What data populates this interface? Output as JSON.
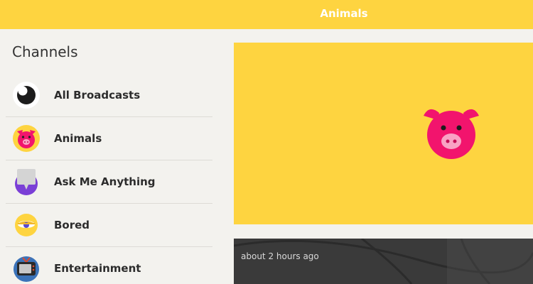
{
  "header": {
    "title": "Animals"
  },
  "sidebar": {
    "heading": "Channels",
    "items": [
      {
        "label": "All Broadcasts",
        "icon": "eye-icon"
      },
      {
        "label": "Animals",
        "icon": "pig-icon"
      },
      {
        "label": "Ask Me Anything",
        "icon": "speech-bubble-icon"
      },
      {
        "label": "Bored",
        "icon": "sleepy-face-icon"
      },
      {
        "label": "Entertainment",
        "icon": "tv-icon"
      }
    ]
  },
  "main": {
    "hero": {
      "icon": "pig-icon",
      "background": "#fed440"
    },
    "card": {
      "time": "about 2 hours ago",
      "title": ""
    }
  },
  "colors": {
    "accent": "#fed440",
    "pig": "#f2146d",
    "purple": "#7a3fd6"
  }
}
